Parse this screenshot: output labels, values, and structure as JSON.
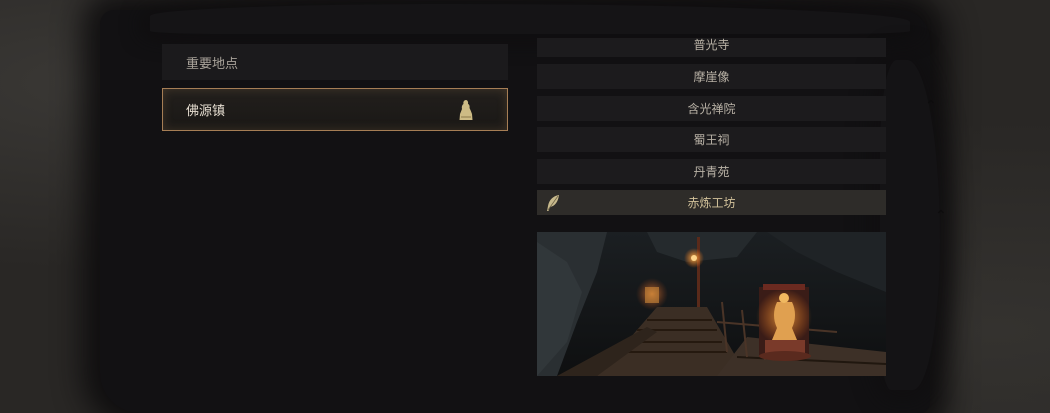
{
  "left": {
    "section_header": "重要地点",
    "selected_location": {
      "label": "佛源镇",
      "icon": "statue-icon"
    }
  },
  "shrines": [
    {
      "label": "普光寺",
      "selected": false
    },
    {
      "label": "摩崖像",
      "selected": false
    },
    {
      "label": "含光禅院",
      "selected": false
    },
    {
      "label": "蜀王祠",
      "selected": false
    },
    {
      "label": "丹青苑",
      "selected": false
    },
    {
      "label": "赤炼工坊",
      "selected": true,
      "icon": "feather-icon"
    }
  ],
  "preview": {
    "icon": "scene-preview-image"
  },
  "colors": {
    "accent_border": "#a67e55",
    "selected_text": "#d2c29a",
    "panel_bg": "#1c1b1d"
  }
}
